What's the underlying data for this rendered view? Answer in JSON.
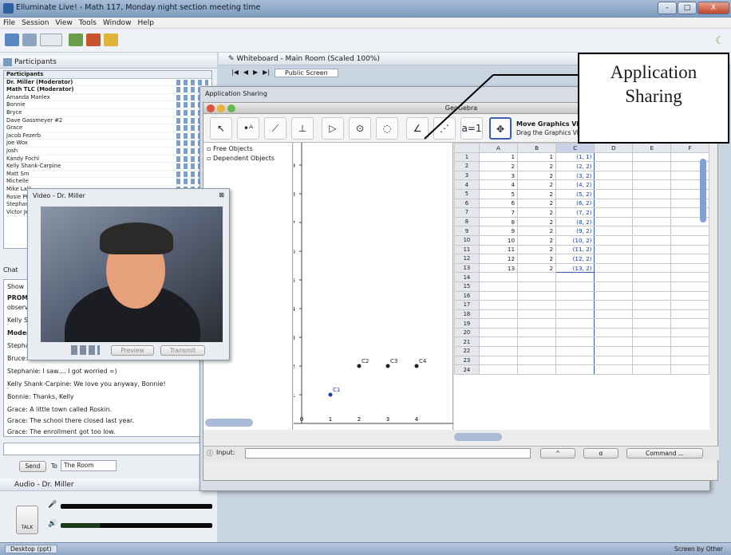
{
  "window": {
    "title": "Elluminate Live! - Math 117, Monday night section meeting time",
    "controls": [
      "-",
      "□",
      "X"
    ]
  },
  "menu": [
    "File",
    "Session",
    "View",
    "Tools",
    "Window",
    "Help"
  ],
  "participants": {
    "title": "Participants",
    "header": "Participants",
    "rows": [
      {
        "name": "Dr. Miller (Moderator)",
        "bold": true
      },
      {
        "name": "Math TLC (Moderator)",
        "bold": true
      },
      {
        "name": "Amanda Manlex",
        "bold": false
      },
      {
        "name": "Bonnie",
        "bold": false
      },
      {
        "name": "Bryce",
        "bold": false
      },
      {
        "name": "Dave Gassmeyer #2",
        "bold": false
      },
      {
        "name": "Grace",
        "bold": false
      },
      {
        "name": "Jacob Fezerb",
        "bold": false
      },
      {
        "name": "Joe Wox",
        "bold": false
      },
      {
        "name": "Josh",
        "bold": false
      },
      {
        "name": "Kandy Fochl",
        "bold": false
      },
      {
        "name": "Kelly Shank-Carpine",
        "bold": false
      },
      {
        "name": "Matt Sm",
        "bold": false
      },
      {
        "name": "Michelle",
        "bold": false
      },
      {
        "name": "Mike Lalli",
        "bold": false
      },
      {
        "name": "Rosie Pf",
        "bold": false
      },
      {
        "name": "Stephani",
        "bold": false
      },
      {
        "name": "Victor Je",
        "bold": false
      }
    ]
  },
  "chat": {
    "title": "Chat",
    "show_label": "Show",
    "lines": [
      "PROMP",
      "observe",
      "Kelly Sh",
      "Moder",
      "Stepha",
      "Bruce:",
      "Stephanie: I saw.... I got worried =)",
      "Kelly Shank-Carpine: We love you anyway, Bonnie!",
      "Bonnie: Thanks, Kelly",
      "Grace: A little town called Roskin.",
      "Grace: The school there closed last year.",
      "Grace: The enrollment got too low."
    ],
    "send_label": "Send",
    "to_label": "To",
    "to_value": "The Room"
  },
  "audio": {
    "title": "Audio - Dr. Miller",
    "talk_label": "TALK"
  },
  "whiteboard": {
    "title": "Whiteboard - Main Room (Scaled 100%)",
    "nav": [
      "|◀",
      "◀",
      "▶",
      "▶|"
    ],
    "screen": "Public Screen"
  },
  "app_sharing": {
    "title": "Application Sharing",
    "app_title": "GeoGebra",
    "move_title": "Move Graphics View",
    "move_desc": "Drag the Graphics Vi",
    "algebra_items": [
      "Free Objects",
      "Dependent Objects"
    ],
    "y_ticks": [
      "9",
      "8",
      "7",
      "6",
      "5",
      "4",
      "3",
      "2",
      "1"
    ],
    "x_ticks": [
      "0",
      "1",
      "2",
      "3",
      "4"
    ],
    "points": [
      {
        "label": "C1",
        "x": 1,
        "y": 1
      },
      {
        "label": "C2",
        "x": 2,
        "y": 2
      },
      {
        "label": "C3",
        "x": 3,
        "y": 2
      },
      {
        "label": "C4",
        "x": 4,
        "y": 2
      }
    ],
    "columns": [
      "A",
      "B",
      "C",
      "D",
      "E",
      "F"
    ],
    "rows": [
      {
        "n": "1",
        "a": "1",
        "b": "1",
        "c": "(1, 1)"
      },
      {
        "n": "2",
        "a": "2",
        "b": "2",
        "c": "(2, 2)"
      },
      {
        "n": "3",
        "a": "3",
        "b": "2",
        "c": "(3, 2)"
      },
      {
        "n": "4",
        "a": "4",
        "b": "2",
        "c": "(4, 2)"
      },
      {
        "n": "5",
        "a": "5",
        "b": "2",
        "c": "(5, 2)"
      },
      {
        "n": "6",
        "a": "6",
        "b": "2",
        "c": "(6, 2)"
      },
      {
        "n": "7",
        "a": "7",
        "b": "2",
        "c": "(7, 2)"
      },
      {
        "n": "8",
        "a": "8",
        "b": "2",
        "c": "(8, 2)"
      },
      {
        "n": "9",
        "a": "9",
        "b": "2",
        "c": "(9, 2)"
      },
      {
        "n": "10",
        "a": "10",
        "b": "2",
        "c": "(10, 2)"
      },
      {
        "n": "11",
        "a": "11",
        "b": "2",
        "c": "(11, 2)"
      },
      {
        "n": "12",
        "a": "12",
        "b": "2",
        "c": "(12, 2)"
      },
      {
        "n": "13",
        "a": "13",
        "b": "2",
        "c": "(13, 2)"
      },
      {
        "n": "14",
        "a": "",
        "b": "",
        "c": ""
      },
      {
        "n": "15",
        "a": "",
        "b": "",
        "c": ""
      },
      {
        "n": "16",
        "a": "",
        "b": "",
        "c": ""
      },
      {
        "n": "17",
        "a": "",
        "b": "",
        "c": ""
      },
      {
        "n": "18",
        "a": "",
        "b": "",
        "c": ""
      },
      {
        "n": "19",
        "a": "",
        "b": "",
        "c": ""
      },
      {
        "n": "20",
        "a": "",
        "b": "",
        "c": ""
      },
      {
        "n": "21",
        "a": "",
        "b": "",
        "c": ""
      },
      {
        "n": "22",
        "a": "",
        "b": "",
        "c": ""
      },
      {
        "n": "23",
        "a": "",
        "b": "",
        "c": ""
      },
      {
        "n": "24",
        "a": "",
        "b": "",
        "c": ""
      }
    ],
    "input_label": "Input:",
    "input_select1": "^",
    "input_select2": "α",
    "command_label": "Command ..."
  },
  "callout": {
    "line1": "Application",
    "line2": "Sharing"
  },
  "video": {
    "title": "Video - Dr. Miller",
    "close": "⊠",
    "preview_label": "Preview",
    "transmit_label": "Transmit"
  },
  "taskbar": {
    "item": "Desktop (ppt)",
    "right_text": "Screen by Other"
  },
  "colors": {
    "point": "#1e3ca8",
    "selection": "#3558b8",
    "face": "#e6a07a"
  }
}
